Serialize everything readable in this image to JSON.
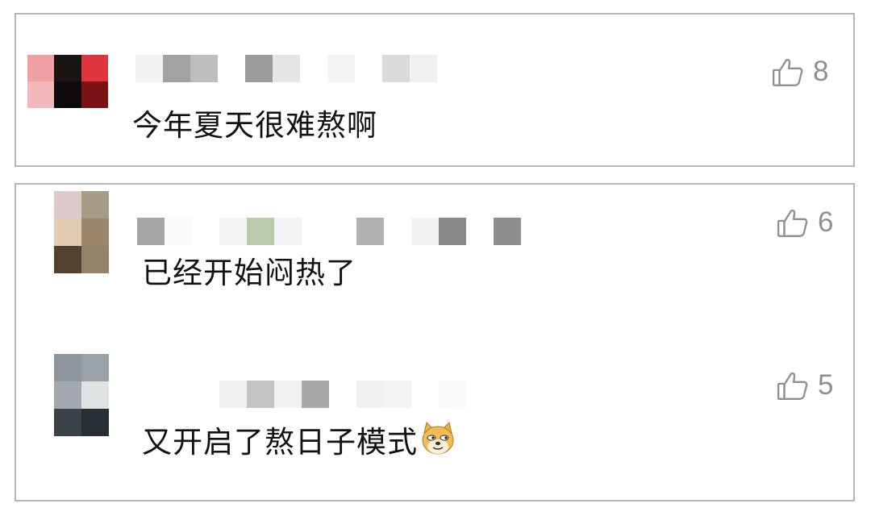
{
  "comments": [
    {
      "text": "今年夏天很难熬啊",
      "likes": "8",
      "emoji": ""
    },
    {
      "text": "已经开始闷热了",
      "likes": "6",
      "emoji": ""
    },
    {
      "text": "又开启了熬日子模式",
      "likes": "5",
      "emoji": "doge-emoji"
    }
  ],
  "icons": {
    "like": "thumbs-up-icon"
  },
  "colors": {
    "border": "#b5b5b5",
    "like_gray": "#8f8f8f",
    "text": "#111111"
  }
}
